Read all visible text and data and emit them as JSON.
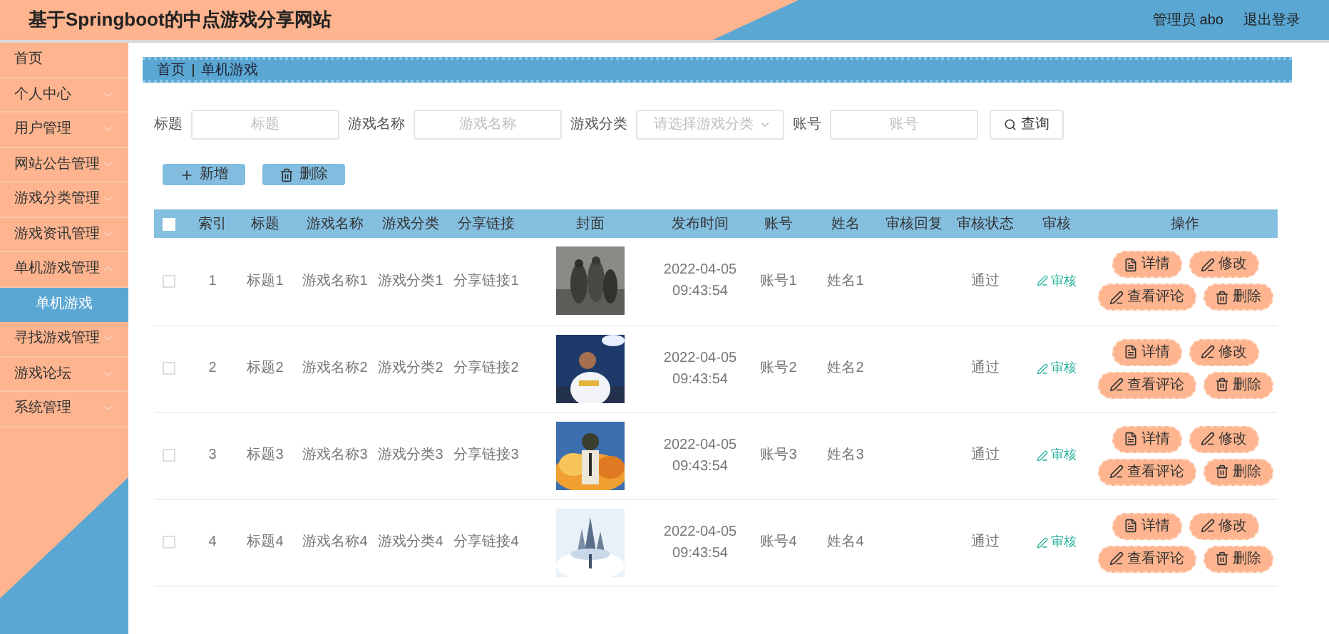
{
  "header": {
    "title": "基于Springboot的中点游戏分享网站",
    "user": "管理员 abo",
    "logout": "退出登录"
  },
  "sidebar": {
    "items": [
      {
        "label": "首页",
        "kind": "link"
      },
      {
        "label": "个人中心",
        "kind": "menu",
        "expanded": false
      },
      {
        "label": "用户管理",
        "kind": "menu",
        "expanded": false
      },
      {
        "label": "网站公告管理",
        "kind": "menu",
        "expanded": false
      },
      {
        "label": "游戏分类管理",
        "kind": "menu",
        "expanded": false
      },
      {
        "label": "游戏资讯管理",
        "kind": "menu",
        "expanded": false
      },
      {
        "label": "单机游戏管理",
        "kind": "menu",
        "expanded": true,
        "children": [
          {
            "label": "单机游戏",
            "selected": true
          }
        ]
      },
      {
        "label": "寻找游戏管理",
        "kind": "menu",
        "expanded": false
      },
      {
        "label": "游戏论坛",
        "kind": "menu",
        "expanded": false
      },
      {
        "label": "系统管理",
        "kind": "menu",
        "expanded": false
      }
    ]
  },
  "breadcrumb": [
    "首页",
    "单机游戏"
  ],
  "filters": [
    {
      "label": "标题",
      "placeholder": "标题",
      "kind": "input"
    },
    {
      "label": "游戏名称",
      "placeholder": "游戏名称",
      "kind": "input"
    },
    {
      "label": "游戏分类",
      "placeholder": "请选择游戏分类",
      "kind": "select"
    },
    {
      "label": "账号",
      "placeholder": "账号",
      "kind": "input"
    }
  ],
  "search_button": "查询",
  "actions": [
    {
      "label": "新增",
      "kind": "add"
    },
    {
      "label": "删除",
      "kind": "delete"
    }
  ],
  "table": {
    "select_all": {
      "checked": false
    },
    "columns": [
      "索引",
      "标题",
      "游戏名称",
      "游戏分类",
      "分享链接",
      "封面",
      "发布时间",
      "账号",
      "姓名",
      "审核回复",
      "审核状态",
      "审核",
      "操作"
    ],
    "rows": [
      {
        "checked": false,
        "index": "1",
        "title": "标题1",
        "game_name": "游戏名称1",
        "category": "游戏分类1",
        "share_link": "分享链接1",
        "publish_time": "2022-04-05 09:43:54",
        "account": "账号1",
        "name": "姓名1",
        "status": "通过",
        "audit": "审核",
        "ops": [
          {
            "label": "详情",
            "kind": "detail"
          },
          {
            "label": "修改",
            "kind": "edit"
          },
          {
            "label": "查看评论",
            "kind": "edit"
          },
          {
            "label": "删除",
            "kind": "delete"
          }
        ]
      },
      {
        "checked": false,
        "index": "2",
        "title": "标题2",
        "game_name": "游戏名称2",
        "category": "游戏分类2",
        "share_link": "分享链接2",
        "publish_time": "2022-04-05 09:43:54",
        "account": "账号2",
        "name": "姓名2",
        "status": "通过",
        "audit": "审核",
        "ops": [
          {
            "label": "详情",
            "kind": "detail"
          },
          {
            "label": "修改",
            "kind": "edit"
          },
          {
            "label": "查看评论",
            "kind": "edit"
          },
          {
            "label": "删除",
            "kind": "delete"
          }
        ]
      },
      {
        "checked": false,
        "index": "3",
        "title": "标题3",
        "game_name": "游戏名称3",
        "category": "游戏分类3",
        "share_link": "分享链接3",
        "publish_time": "2022-04-05 09:43:54",
        "account": "账号3",
        "name": "姓名3",
        "status": "通过",
        "audit": "审核",
        "ops": [
          {
            "label": "详情",
            "kind": "detail"
          },
          {
            "label": "修改",
            "kind": "edit"
          },
          {
            "label": "查看评论",
            "kind": "edit"
          },
          {
            "label": "删除",
            "kind": "delete"
          }
        ]
      },
      {
        "checked": false,
        "index": "4",
        "title": "标题4",
        "game_name": "游戏名称4",
        "category": "游戏分类4",
        "share_link": "分享链接4",
        "publish_time": "2022-04-05 09:43:54",
        "account": "账号4",
        "name": "姓名4",
        "status": "通过",
        "audit": "审核",
        "ops": [
          {
            "label": "详情",
            "kind": "detail"
          },
          {
            "label": "修改",
            "kind": "edit"
          },
          {
            "label": "查看评论",
            "kind": "edit"
          },
          {
            "label": "删除",
            "kind": "delete"
          }
        ]
      }
    ]
  }
}
